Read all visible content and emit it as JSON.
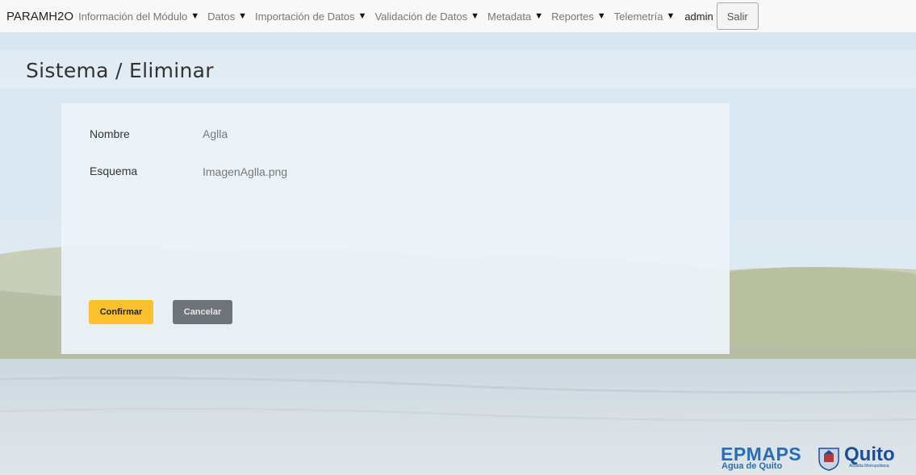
{
  "navbar": {
    "brand": "PARAMH2O",
    "items": [
      {
        "label": "Información del Módulo"
      },
      {
        "label": "Datos"
      },
      {
        "label": "Importación de Datos"
      },
      {
        "label": "Validación de Datos"
      },
      {
        "label": "Metadata"
      },
      {
        "label": "Reportes"
      },
      {
        "label": "Telemetría"
      }
    ],
    "caret_icon": "caret-down-icon",
    "user": "admin",
    "logout_label": "Salir"
  },
  "page": {
    "title": "Sistema / Eliminar"
  },
  "detail": {
    "fields": [
      {
        "label": "Nombre",
        "value": "Aglla"
      },
      {
        "label": "Esquema",
        "value": "ImagenAglla.png"
      }
    ]
  },
  "actions": {
    "confirm_label": "Confirmar",
    "cancel_label": "Cancelar",
    "confirm_color": "#fbc02d",
    "cancel_color": "#6e7479"
  },
  "footer_logo": {
    "org": "EPMAPS",
    "org_sub": "Agua de Quito",
    "city": "Quito",
    "city_sub": "Alcaldía Metropolitana",
    "brand_color": "#2a6db5"
  }
}
